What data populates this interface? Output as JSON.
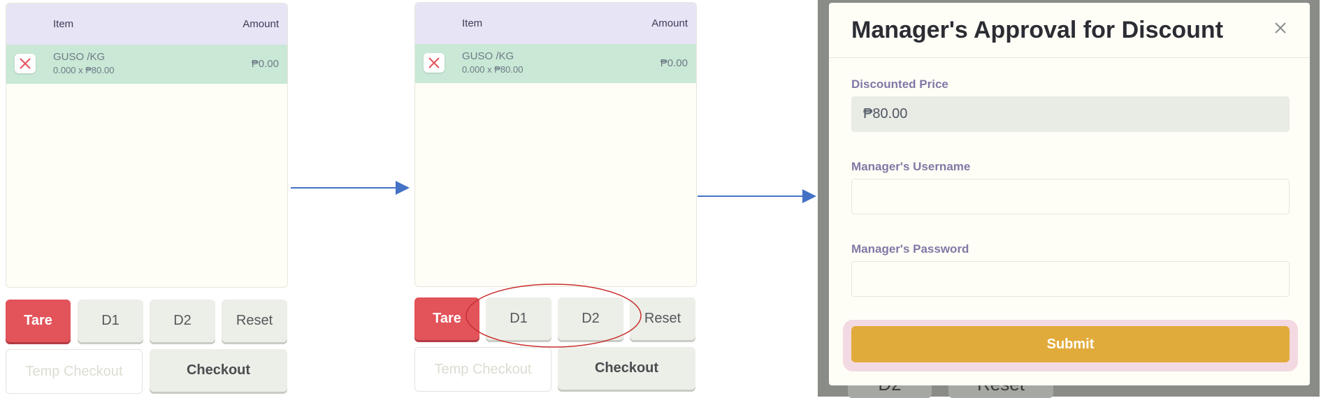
{
  "pos_panel": {
    "header": {
      "item_label": "Item",
      "amount_label": "Amount"
    },
    "line_item": {
      "name": "GUSO /KG",
      "detail": "0.000 x ₱80.00",
      "amount": "₱0.00"
    },
    "buttons": {
      "tare": "Tare",
      "d1": "D1",
      "d2": "D2",
      "reset": "Reset",
      "temp_checkout": "Temp Checkout",
      "checkout": "Checkout"
    }
  },
  "modal": {
    "title": "Manager's Approval for Discount",
    "close_icon": "close-icon",
    "discounted_price_label": "Discounted Price",
    "discounted_price_value": "₱80.00",
    "username_label": "Manager's Username",
    "username_value": "",
    "password_label": "Manager's Password",
    "password_value": "",
    "submit_label": "Submit",
    "background_buttons": {
      "d2": "D2",
      "reset": "Reset"
    }
  },
  "colors": {
    "accent_red": "#e2535a",
    "row_green": "#c9e8d6",
    "header_lavender": "#e7e5f5",
    "submit_gold": "#e1ab3b",
    "arrow_blue": "#4472c4",
    "highlight_ellipse": "#c8302d"
  }
}
